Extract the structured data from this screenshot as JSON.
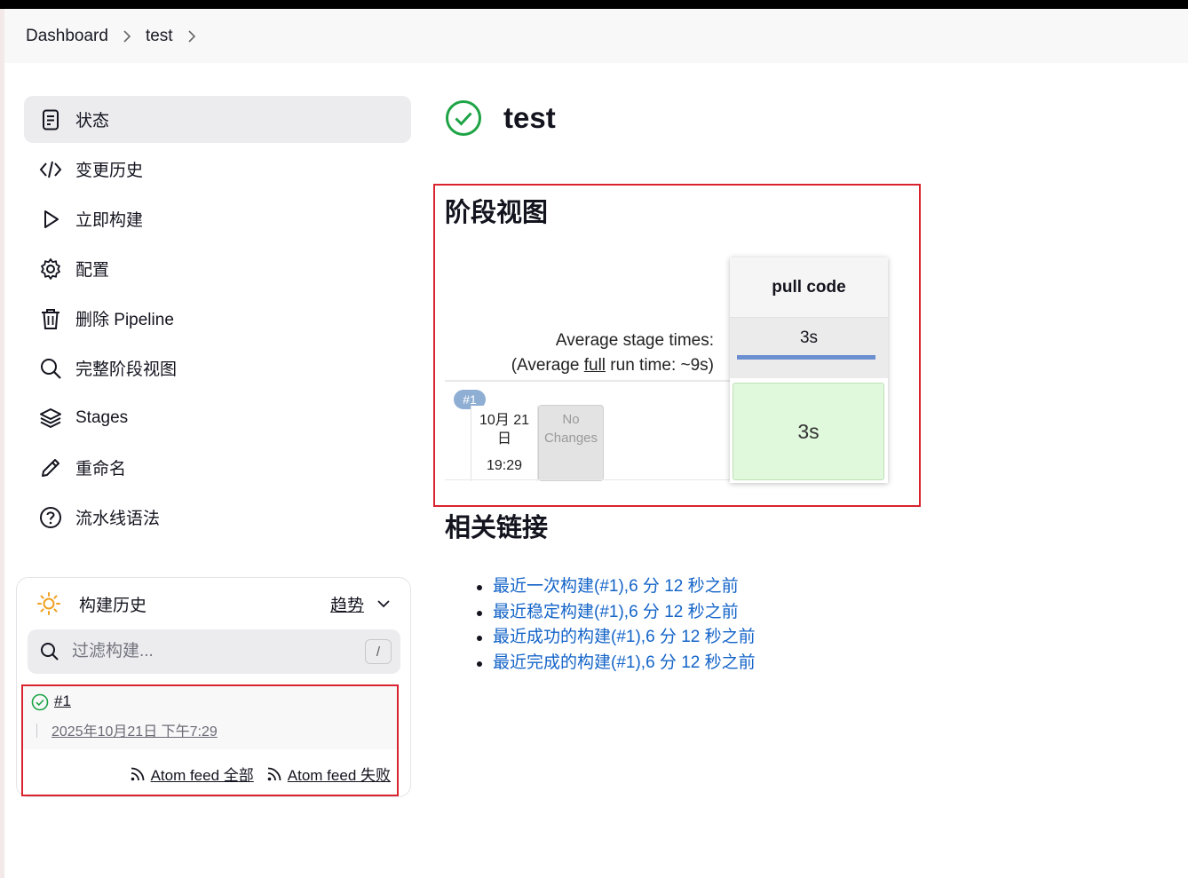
{
  "breadcrumb": {
    "items": [
      "Dashboard",
      "test"
    ]
  },
  "sidebar": {
    "items": [
      {
        "label": "状态",
        "icon": "document-icon"
      },
      {
        "label": "变更历史",
        "icon": "code-icon"
      },
      {
        "label": "立即构建",
        "icon": "play-icon"
      },
      {
        "label": "配置",
        "icon": "gear-icon"
      },
      {
        "label": "删除 Pipeline",
        "icon": "trash-icon"
      },
      {
        "label": "完整阶段视图",
        "icon": "search-icon"
      },
      {
        "label": "Stages",
        "icon": "layers-icon"
      },
      {
        "label": "重命名",
        "icon": "pencil-icon"
      },
      {
        "label": "流水线语法",
        "icon": "help-icon"
      }
    ]
  },
  "history": {
    "title": "构建历史",
    "trend": "趋势",
    "filter_placeholder": "过滤构建...",
    "shortcut_key": "/",
    "builds": [
      {
        "number": "#1",
        "date": "2025年10月21日 下午7:29",
        "status": "success"
      }
    ],
    "feeds": [
      "Atom feed 全部",
      "Atom feed 失败"
    ]
  },
  "main": {
    "title": "test",
    "stage_view_heading": "阶段视图",
    "related_heading": "相关链接",
    "related_links": [
      "最近一次构建(#1),6 分 12 秒之前",
      "最近稳定构建(#1),6 分 12 秒之前",
      "最近成功的构建(#1),6 分 12 秒之前",
      "最近完成的构建(#1),6 分 12 秒之前"
    ]
  },
  "stage_view": {
    "avg_label_1": "Average stage times:",
    "avg_label_2_pre": "(Average ",
    "avg_label_2_full": "full",
    "avg_label_2_post": " run time: ~9s)",
    "stage_name": "pull code",
    "stage_avg": "3s",
    "stage_avg_fill": 1.0,
    "run": {
      "badge": "#1",
      "date": "10月 21 日",
      "time": "19:29",
      "changes": "No Changes",
      "stage_time": "3s"
    }
  },
  "colors": {
    "success": "#1ea446",
    "link": "#1464c8",
    "highlight": "#d9232f",
    "stage_success_bg": "#e0f8dc"
  }
}
